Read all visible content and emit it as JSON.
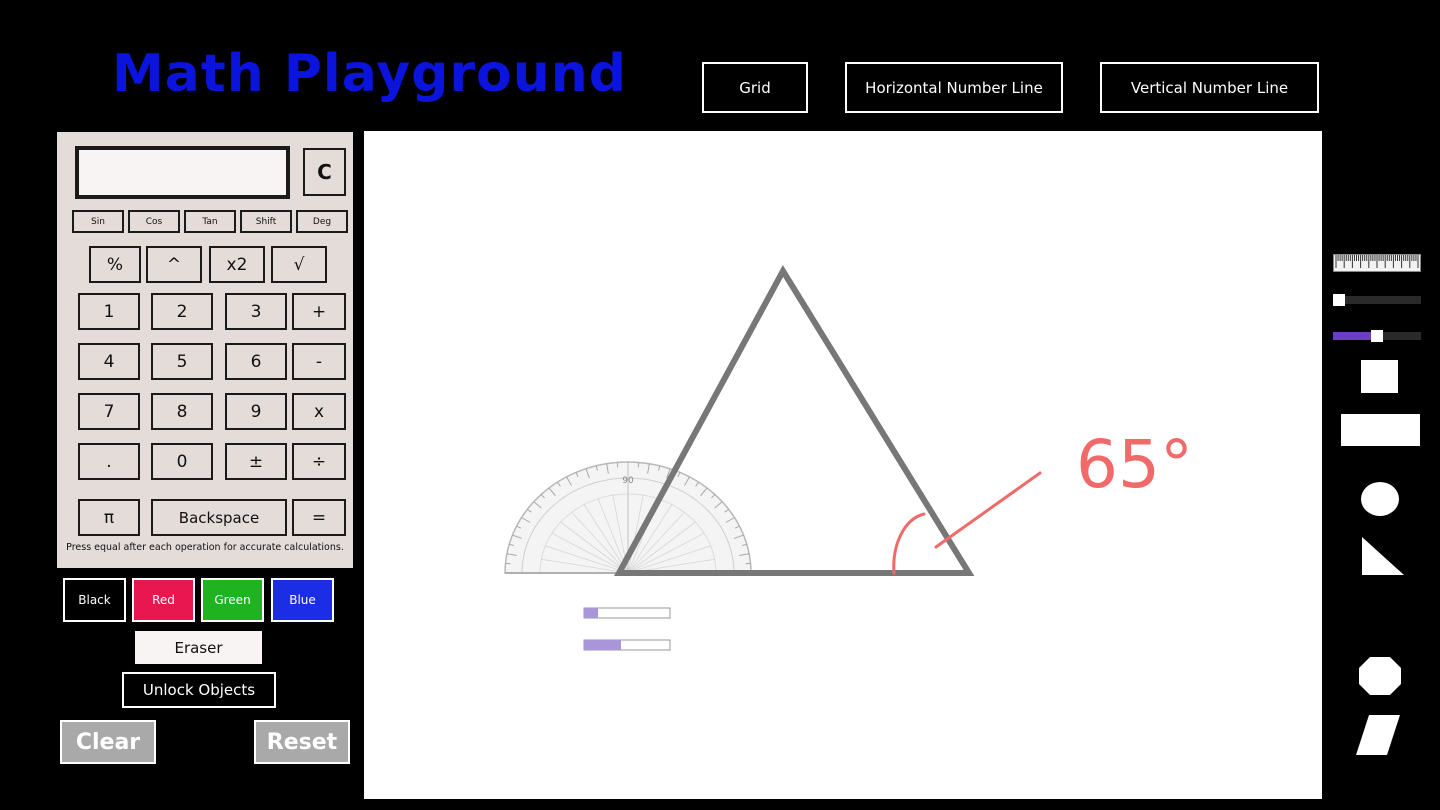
{
  "app": {
    "title": "Math Playground"
  },
  "toolbar": {
    "grid": "Grid",
    "horizontal_number_line": "Horizontal Number Line",
    "vertical_number_line": "Vertical Number Line"
  },
  "calculator": {
    "clear": "C",
    "display_value": "",
    "scientific": [
      "Sin",
      "Cos",
      "Tan",
      "Shift",
      "Deg"
    ],
    "keys": {
      "percent": "%",
      "power": "^",
      "square": "x2",
      "sqrt": "√",
      "k1": "1",
      "k2": "2",
      "k3": "3",
      "plus": "+",
      "k4": "4",
      "k5": "5",
      "k6": "6",
      "minus": "-",
      "k7": "7",
      "k8": "8",
      "k9": "9",
      "times": "x",
      "dot": ".",
      "k0": "0",
      "plusminus": "±",
      "divide": "÷",
      "pi": "π",
      "backspace": "Backspace",
      "equals": "="
    },
    "note": "Press equal after each operation for accurate calculations."
  },
  "colors": {
    "black": {
      "label": "Black",
      "hex": "#000000"
    },
    "red": {
      "label": "Red",
      "hex": "#e8174f"
    },
    "green": {
      "label": "Green",
      "hex": "#1fb41f"
    },
    "blue": {
      "label": "Blue",
      "hex": "#1b2ee6"
    }
  },
  "controls": {
    "eraser": "Eraser",
    "unlock": "Unlock Objects",
    "clear": "Clear",
    "reset": "Reset"
  },
  "canvas": {
    "annotation": "65°",
    "protractor_label": "90",
    "ink_color": "#f06a6a",
    "shape_color": "#777777",
    "slider_color": "#a896d8"
  },
  "sidebar": {
    "slider_accent": "#6a3fc4",
    "tools": [
      "ruler-icon",
      "slider",
      "slider",
      "square-icon",
      "rectangle-icon",
      "circle-icon",
      "right-triangle-icon",
      "octagon-icon",
      "parallelogram-icon"
    ]
  }
}
